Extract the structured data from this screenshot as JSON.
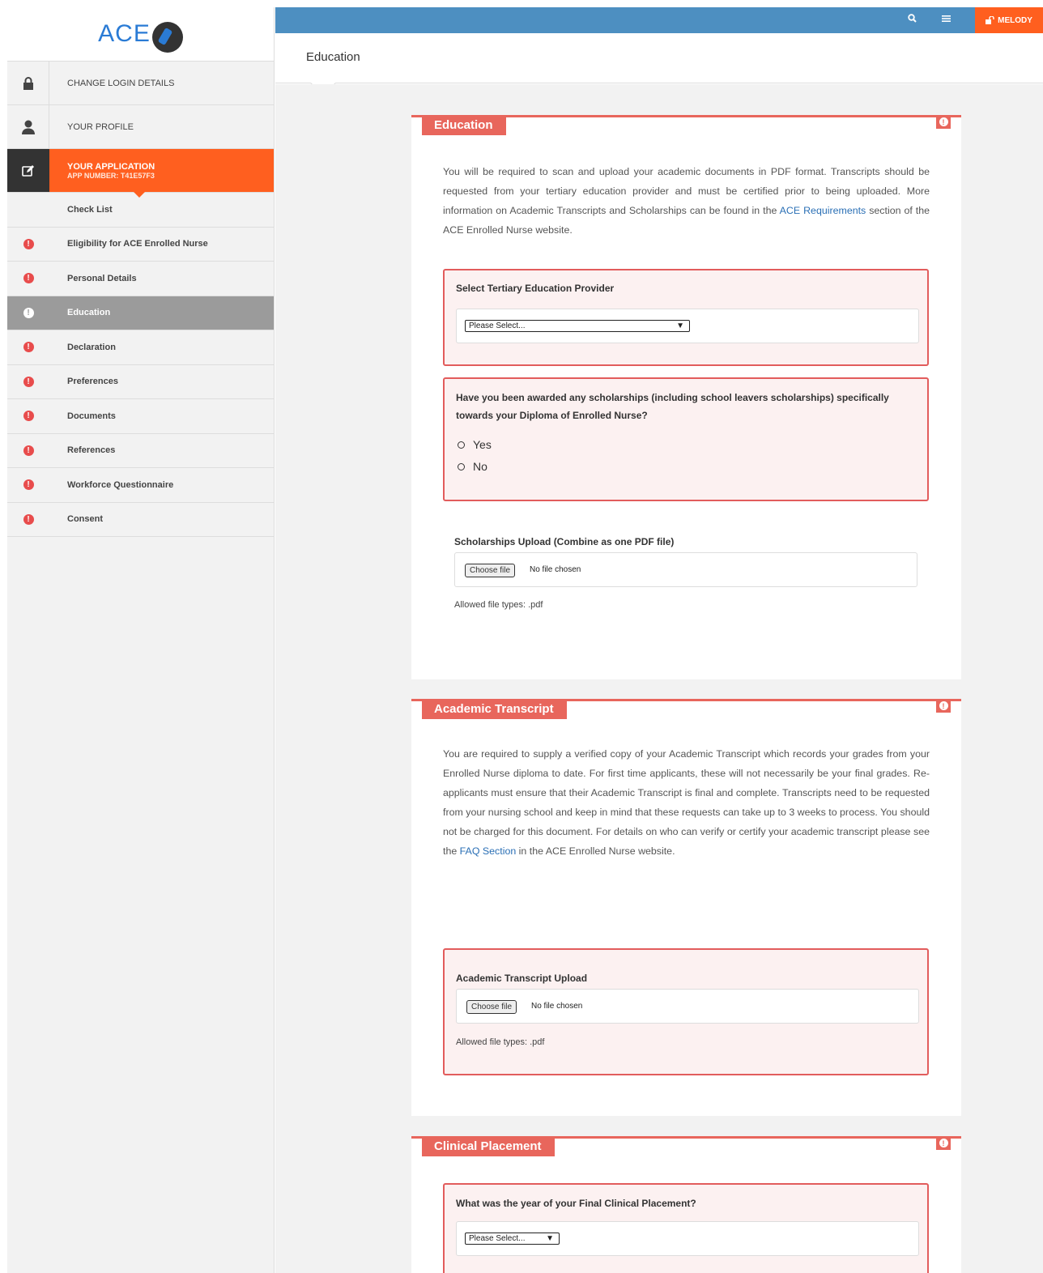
{
  "brand": {
    "logo_text": "ACE"
  },
  "topbar": {
    "search_icon": "search-icon",
    "menu_icon": "menu-icon",
    "user_label": "MELODY"
  },
  "sidebar": {
    "change_login": "CHANGE LOGIN DETAILS",
    "your_profile": "YOUR PROFILE",
    "your_application": "YOUR APPLICATION",
    "app_number": "APP NUMBER: T41E57F3",
    "items": [
      {
        "label": "Check List"
      },
      {
        "label": "Eligibility for ACE Enrolled Nurse"
      },
      {
        "label": "Personal Details"
      },
      {
        "label": "Education"
      },
      {
        "label": "Declaration"
      },
      {
        "label": "Preferences"
      },
      {
        "label": "Documents"
      },
      {
        "label": "References"
      },
      {
        "label": "Workforce Questionnaire"
      },
      {
        "label": "Consent"
      }
    ]
  },
  "page": {
    "title": "Education"
  },
  "education": {
    "tag": "Education",
    "desc_1": "You will be required to scan and upload your academic documents in PDF format. Transcripts should be requested from your tertiary education provider and must be certified prior to being uploaded. More information on Academic Transcripts and Scholarships can be found in the ",
    "desc_link": "ACE Requirements",
    "desc_2": " section of the ACE Enrolled Nurse website.",
    "provider_label": "Select Tertiary Education Provider",
    "provider_value": "Please Select...",
    "scholarship_question": "Have you been awarded any scholarships (including school leavers scholarships) specifically towards your Diploma of Enrolled Nurse?",
    "opt_yes": "Yes",
    "opt_no": "No",
    "upload_label": "Scholarships Upload (Combine as one PDF file)",
    "choose_file": "Choose file",
    "no_file": "No file chosen",
    "allowed": "Allowed file types: .pdf"
  },
  "transcript": {
    "tag": "Academic Transcript",
    "desc_1": "You are required to supply a verified copy of your Academic Transcript which records your grades from your Enrolled Nurse diploma to date. For first time applicants, these will not necessarily be your final grades. Re-applicants must ensure that their Academic Transcript is final and complete. Transcripts need to be requested from your nursing school and keep in mind that these requests can take up to 3 weeks to process. You should not be charged for this document. For details on who can verify or certify your academic transcript please see the ",
    "desc_link": "FAQ Section",
    "desc_2": " in the ACE Enrolled Nurse website.",
    "upload_label": "Academic Transcript Upload",
    "choose_file": "Choose file",
    "no_file": "No file chosen",
    "allowed": "Allowed file types: .pdf"
  },
  "clinical": {
    "tag": "Clinical Placement",
    "question": "What was the year of your Final Clinical Placement?",
    "value": "Please Select..."
  },
  "colors": {
    "accent": "#ff5f1f",
    "topbar": "#4d8fc1",
    "panel": "#e8665c",
    "alert": "#e84c4c"
  }
}
